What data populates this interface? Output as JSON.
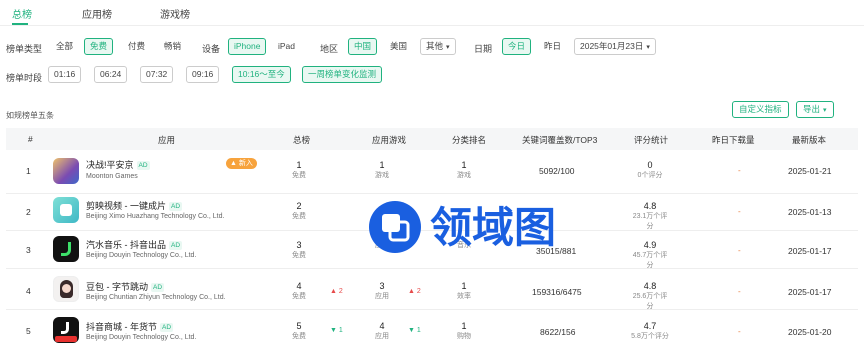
{
  "tabs": {
    "items": [
      "总榜",
      "应用榜",
      "游戏榜"
    ]
  },
  "filters": {
    "row1": {
      "label": "榜单类型",
      "types": [
        "全部",
        "免费",
        "付费",
        "畅销"
      ],
      "device_label": "设备",
      "devices": [
        "iPhone",
        "iPad"
      ],
      "country_label": "地区",
      "countries": [
        "中国",
        "美国"
      ],
      "other": "其他",
      "date_label": "日期",
      "date_today": "今日",
      "date_yesterday": "昨日",
      "date_value": "2025年01月23日"
    },
    "row2": {
      "label": "榜单时段",
      "times": [
        "01:16",
        "06:24",
        "07:32",
        "09:16"
      ],
      "active_time": "10:16～至今",
      "compare": "一周榜单变化监测"
    }
  },
  "toolbar": {
    "total": "如规榜单五条",
    "custom_cols": "自定义指标",
    "export": "导出"
  },
  "table": {
    "headers": [
      "#",
      "应用",
      "总榜",
      "应用游戏",
      "分类排名",
      "关键词覆盖数/TOP3",
      "评分统计",
      "昨日下载量",
      "最新版本"
    ],
    "rows": [
      {
        "idx": "1",
        "name": "决战!平安京",
        "ad": "AD",
        "dev": "Moonton Games",
        "badge": "▲ 新入",
        "total": "1",
        "total_sub": "免费",
        "app_rank": "1",
        "app_sub": "游戏",
        "cat_rank": "1",
        "cat_sub": "游戏",
        "kw": "5092/100",
        "rating": "0",
        "rating_sub": "0个评分",
        "dl": "-",
        "version": "2025-01-21"
      },
      {
        "idx": "2",
        "name": "剪映视频 - 一键成片",
        "ad": "AD",
        "dev": "Beijing Ximo Huazhang Technology Co., Ltd.",
        "badge": "",
        "total": "2",
        "total_sub": "免费",
        "app_rank": "",
        "app_sub": "",
        "cat_rank": "",
        "cat_sub": "",
        "kw": "",
        "rating": "4.8",
        "rating_sub": "23.1万个评分",
        "dl": "-",
        "version": "2025-01-13"
      },
      {
        "idx": "3",
        "name": "汽水音乐 - 抖音出品",
        "ad": "AD",
        "dev": "Beijing Douyin Technology Co., Ltd.",
        "badge": "",
        "total": "3",
        "total_sub": "免费",
        "app_rank": "",
        "app_sub": "应用",
        "cat_rank": "",
        "cat_sub": "音乐",
        "kw": "35015/881",
        "rating": "4.9",
        "rating_sub": "45.7万个评分",
        "dl": "-",
        "version": "2025-01-17"
      },
      {
        "idx": "4",
        "name": "豆包 - 字节跳动",
        "ad": "AD",
        "dev": "Beijing Chuntian Zhiyun Technology Co., Ltd.",
        "badge": "",
        "total": "4",
        "total_sub": "免费",
        "total_trend": "▲ 2",
        "app_rank": "3",
        "app_sub": "应用",
        "app_trend": "▲ 2",
        "cat_rank": "1",
        "cat_sub": "效率",
        "kw": "159316/6475",
        "rating": "4.8",
        "rating_sub": "25.6万个评分",
        "dl": "-",
        "version": "2025-01-17"
      },
      {
        "idx": "5",
        "name": "抖音商城 - 年货节",
        "ad": "AD",
        "dev": "Beijing Douyin Technology Co., Ltd.",
        "badge": "",
        "total": "5",
        "total_sub": "免费",
        "total_trend": "▼ 1",
        "app_rank": "4",
        "app_sub": "应用",
        "app_trend": "▼ 1",
        "cat_rank": "1",
        "cat_sub": "购物",
        "kw": "8622/156",
        "rating": "4.7",
        "rating_sub": "5.8万个评分",
        "dl": "-",
        "version": "2025-01-20"
      }
    ]
  },
  "watermark": {
    "text": "领域图"
  },
  "colors": {
    "accent": "#20b27f",
    "badge": "#f7a33d",
    "up": "#e64a4a",
    "watermark": "#1a5fe0"
  }
}
